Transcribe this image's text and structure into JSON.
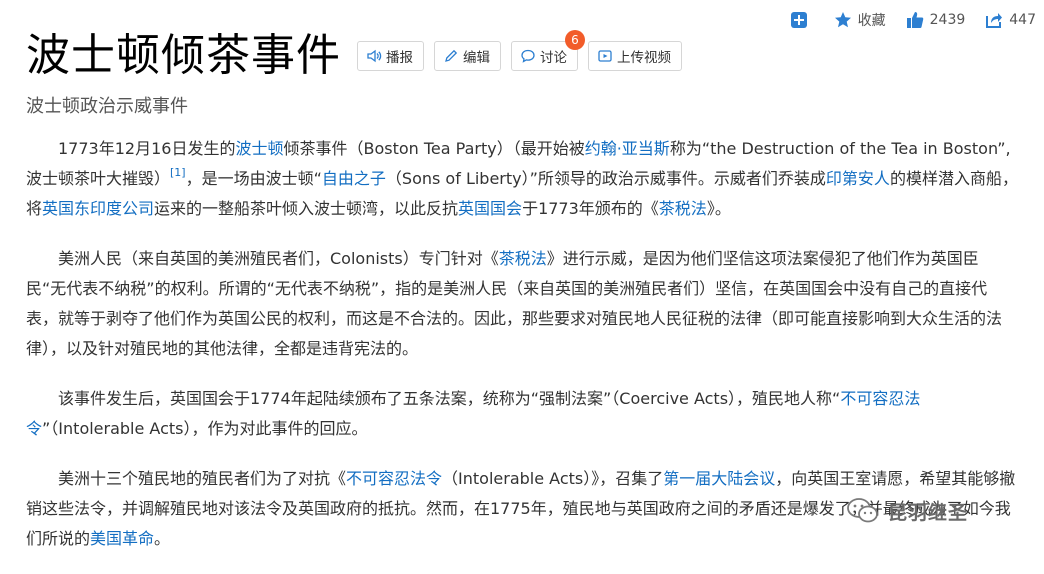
{
  "actions": {
    "add_icon": "plus-square-icon",
    "collect_label": "收藏",
    "like_count": "2439",
    "share_count": "447"
  },
  "header": {
    "title": "波士顿倾茶事件",
    "subtitle": "波士顿政治示威事件",
    "buttons": {
      "broadcast": "播报",
      "edit": "编辑",
      "discuss": "讨论",
      "discuss_badge": "6",
      "upload_video": "上传视频"
    }
  },
  "paragraphs": {
    "p1": {
      "t1": "1773年12月16日发生的",
      "link_boston": "波士顿",
      "t2": "倾茶事件（Boston Tea Party）（最开始被",
      "link_adams": "约翰·亚当斯",
      "t3": "称为“the Destruction of the Tea in Boston”,波士顿茶叶大摧毁）",
      "ref": "[1]",
      "t4": "，是一场由波士顿“",
      "link_sons": "自由之子",
      "t5": "（Sons of Liberty）”所领导的政治示威事件。示威者们乔装成",
      "link_indian": "印第安人",
      "t6": "的模样潜入商船，将",
      "link_eic": "英国东印度公司",
      "t7": "运来的一整船茶叶倾入波士顿湾，以此反抗",
      "link_parliament": "英国国会",
      "t8": "于1773年颁布的《",
      "link_tea_act": "茶税法",
      "t9": "》。"
    },
    "p2": {
      "t1": "美洲人民（来自英国的美洲殖民者们，Colonists）专门针对《",
      "link_tea_act": "茶税法",
      "t2": "》进行示威，是因为他们坚信这项法案侵犯了他们作为英国臣民“无代表不纳税”的权利。所谓的“无代表不纳税”，指的是美洲人民（来自英国的美洲殖民者们）坚信，在英国国会中没有自己的直接代表，就等于剥夺了他们作为英国公民的权利，而这是不合法的。因此，那些要求对殖民地人民征税的法律（即可能直接影响到大众生活的法律），以及针对殖民地的其他法律，全都是违背宪法的。"
    },
    "p3": {
      "t1": "该事件发生后，英国国会于1774年起陆续颁布了五条法案，统称为“强制法案”（Coercive Acts），殖民地人称“",
      "link_intolerable": "不可容忍法令",
      "t2": "”（Intolerable Acts），作为对此事件的回应。"
    },
    "p4": {
      "t1": "美洲十三个殖民地的殖民者们为了对抗《",
      "link_intolerable": "不可容忍法令",
      "t2": "（Intolerable Acts）》，召集了",
      "link_congress": "第一届大陆会议",
      "t3": "，向英国王室请愿，希望其能够撤销这些法令，并调解殖民地对该法令及英国政府的抵抗。然而，在1775年，殖民地与英国政府之间的矛盾还是爆发了，并最终成为了如今我们所说的",
      "link_revolution": "美国革命",
      "t4": "。"
    }
  },
  "watermark": {
    "text": "昆羽继圣"
  },
  "colors": {
    "link": "#136ec2",
    "icon_blue": "#2d7fd1",
    "badge": "#f25c2a"
  }
}
